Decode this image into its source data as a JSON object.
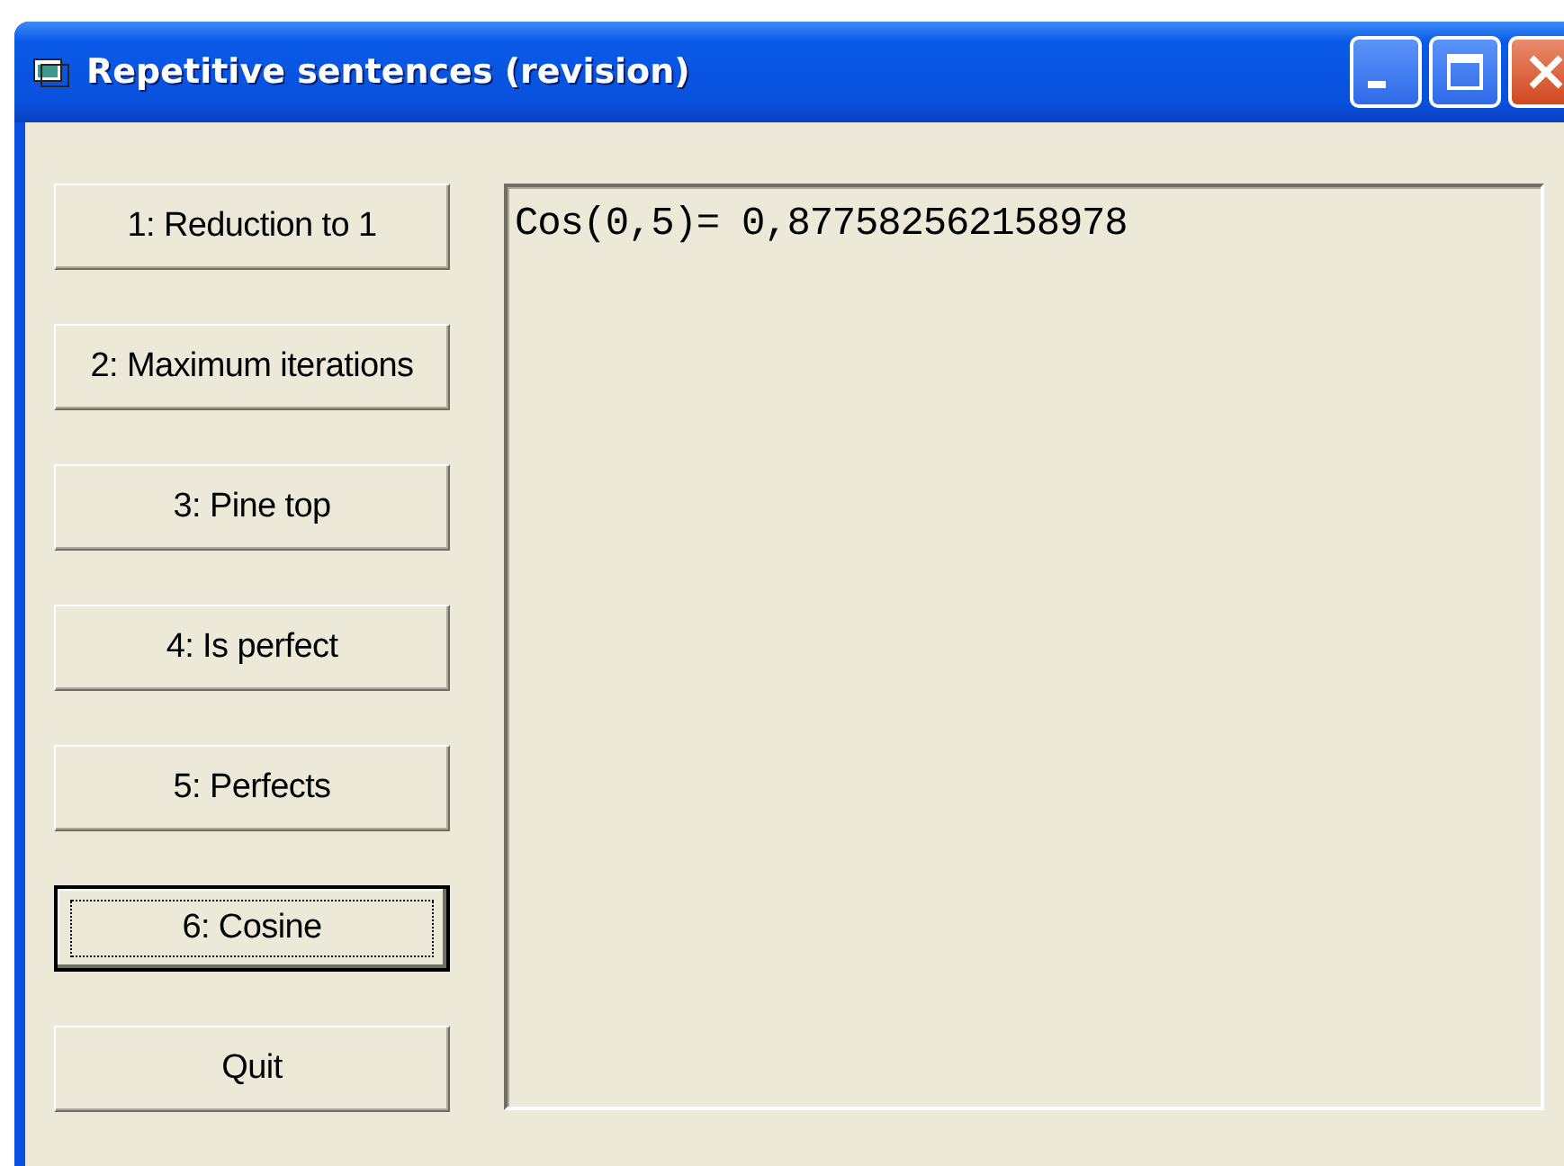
{
  "window": {
    "title": "Repetitive sentences (revision)"
  },
  "buttons": [
    {
      "label": "1: Reduction to 1",
      "focused": false
    },
    {
      "label": "2: Maximum iterations",
      "focused": false
    },
    {
      "label": "3: Pine top",
      "focused": false
    },
    {
      "label": "4: Is perfect",
      "focused": false
    },
    {
      "label": "5: Perfects",
      "focused": false
    },
    {
      "label": "6: Cosine",
      "focused": true
    },
    {
      "label": "Quit",
      "focused": false
    }
  ],
  "output": {
    "lines": [
      "Cos(0,5)= 0,877582562158978"
    ]
  }
}
